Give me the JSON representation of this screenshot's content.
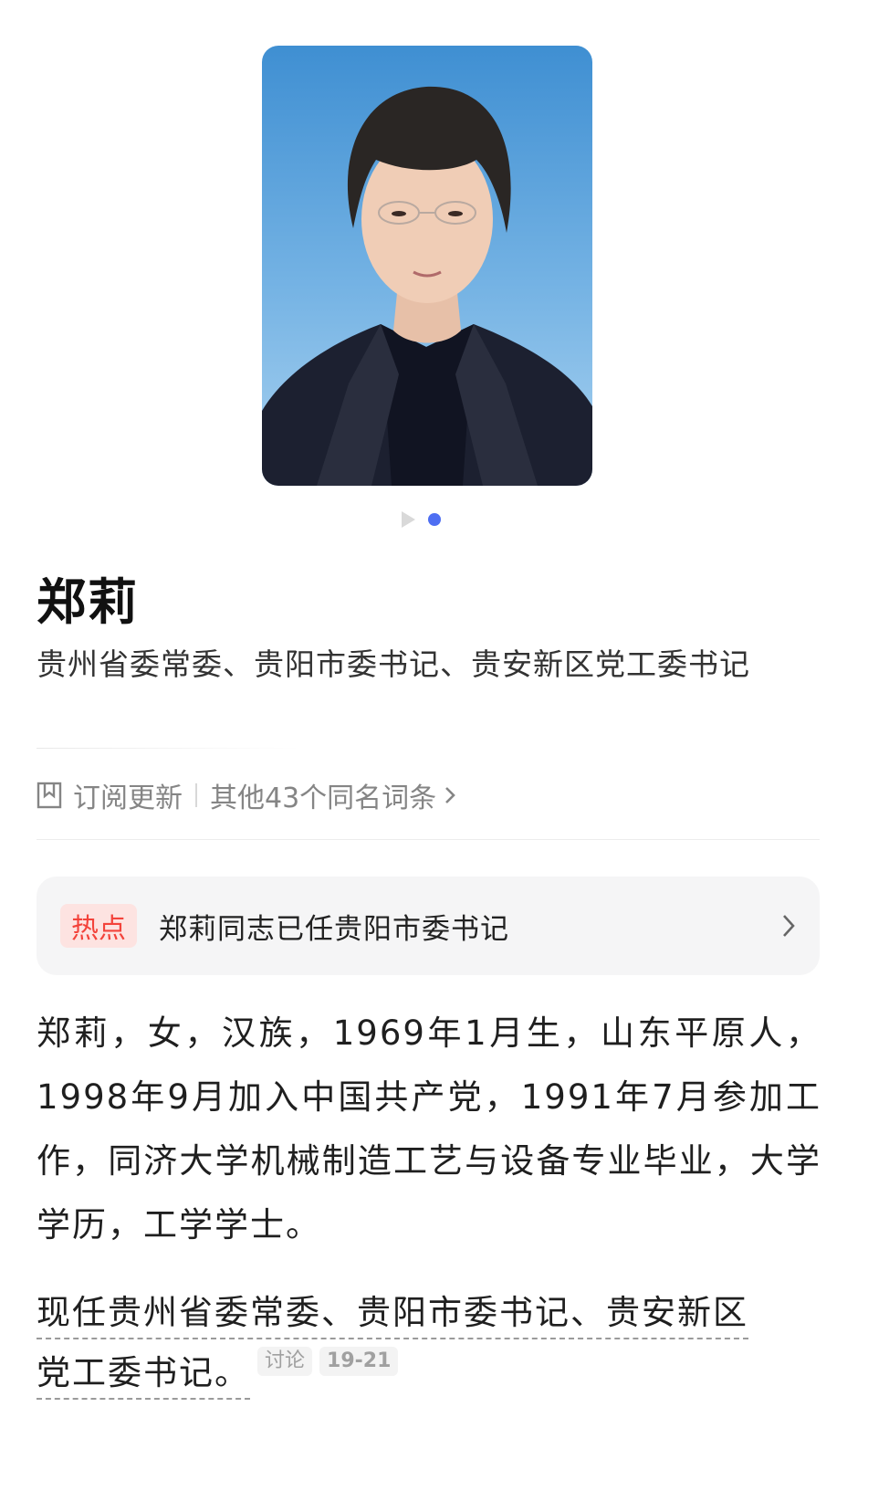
{
  "profile": {
    "name": "郑莉",
    "subtitle": "贵州省委常委、贵阳市委书记、贵安新区党工委书记",
    "subscribe_label": "订阅更新",
    "same_name_label": "其他43个同名词条"
  },
  "carousel": {
    "total": 2,
    "active_index": 1
  },
  "hot": {
    "badge": "热点",
    "text": "郑莉同志已任贵阳市委书记"
  },
  "bio": "郑莉，女，汉族，1969年1月生，山东平原人，1998年9月加入中国共产党，1991年7月参加工作，同济大学机械制造工艺与设备专业毕业，大学学历，工学学士。",
  "current_position": {
    "line1": "现任贵州省委常委、贵阳市委书记、贵安新区",
    "line2": "党工委书记。",
    "tag_discuss": "讨论",
    "tag_range": "19-21"
  },
  "colors": {
    "accent": "#4e6ef2",
    "hot_red": "#f3433b",
    "hot_bg": "#fde3e1",
    "card_bg": "#f5f5f6",
    "portrait_bg": "#4f95d2"
  },
  "icons": {
    "play": "play-icon",
    "bookmark": "bookmark-icon",
    "chevron": "chevron-right-icon"
  }
}
